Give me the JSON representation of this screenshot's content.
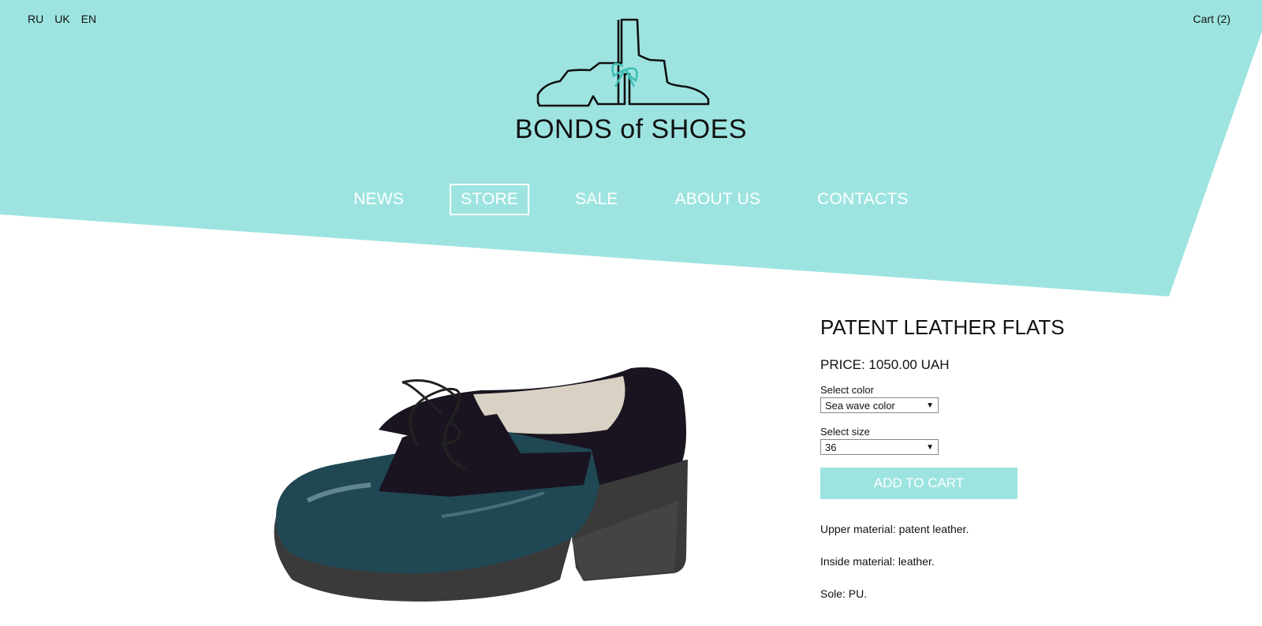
{
  "colors": {
    "header_bg": "#9de4e0",
    "accent": "#3dbdb5",
    "nav_text": "#ffffff",
    "button_bg": "#9de4e0"
  },
  "languages": [
    "RU",
    "UK",
    "EN"
  ],
  "cart": {
    "label": "Cart (2)"
  },
  "brand": {
    "name": "BONDS of SHOES",
    "icon": "shoe-bow-logo"
  },
  "nav": {
    "items": [
      {
        "label": "NEWS"
      },
      {
        "label": "STORE",
        "active": true
      },
      {
        "label": "SALE"
      },
      {
        "label": "ABOUT US"
      },
      {
        "label": "CONTACTS"
      }
    ]
  },
  "product": {
    "title": "PATENT LEATHER FLATS",
    "price": "PRICE: 1050.00 UAH",
    "color_label": "Select color",
    "color_value": "Sea wave color",
    "size_label": "Select size",
    "size_value": "36",
    "add_to_cart": "ADD TO CART",
    "specs": [
      "Upper material: patent leather.",
      "Inside material: leather.",
      "Sole: PU."
    ],
    "image": "teal-patent-lace-up-shoe"
  }
}
